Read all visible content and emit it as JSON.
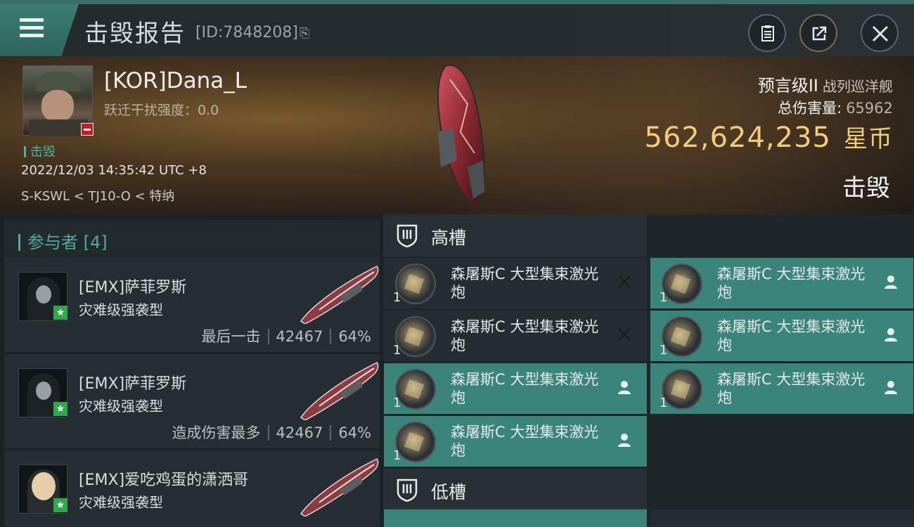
{
  "header": {
    "title": "击毁报告",
    "report_id": "[ID:7848208]"
  },
  "victim": {
    "name": "[KOR]Dana_L",
    "warp_label": "跃迁干扰强度：",
    "warp_value": "0.0",
    "kill_tag": "击毁",
    "timestamp": "2022/12/03 14:35:42 UTC +8",
    "location": "S-KSWL < TJ10-O < 特纳",
    "ship_name": "预言级II",
    "ship_class": "战列巡洋舰",
    "damage_label": "总伤害量:",
    "damage_value": "65962",
    "isk_value": "562,624,235",
    "isk_unit": "星币",
    "result": "击毁"
  },
  "participants": {
    "title": "参与者 [4]",
    "items": [
      {
        "name": "[EMX]萨菲罗斯",
        "ship": "灾难级强袭型",
        "role": "最后一击",
        "damage": "42467",
        "percent": "64%"
      },
      {
        "name": "[EMX]萨菲罗斯",
        "ship": "灾难级强袭型",
        "role": "造成伤害最多",
        "damage": "42467",
        "percent": "64%"
      },
      {
        "name": "[EMX]爱吃鸡蛋的潇洒哥",
        "ship": "灾难级强袭型"
      }
    ]
  },
  "fitting": {
    "high_slot_label": "高槽",
    "low_slot_label": "低槽",
    "modules": [
      {
        "name": "森屠斯C 大型集束激光炮",
        "qty": "1",
        "status": "destroyed"
      },
      {
        "name": "森屠斯C 大型集束激光炮",
        "qty": "1",
        "status": "dropped"
      },
      {
        "name": "森屠斯C 大型集束激光炮",
        "qty": "1",
        "status": "destroyed"
      },
      {
        "name": "森屠斯C 大型集束激光炮",
        "qty": "1",
        "status": "dropped"
      },
      {
        "name": "森屠斯C 大型集束激光炮",
        "qty": "1",
        "status": "dropped"
      },
      {
        "name": "森屠斯C 大型集束激光炮",
        "qty": "1",
        "status": "dropped"
      },
      {
        "name": "森屠斯C 大型集束激光炮",
        "qty": "1",
        "status": "dropped"
      }
    ]
  },
  "icons": {
    "menu": "menu-icon",
    "clipboard": "clipboard-icon",
    "share": "share-icon",
    "close": "close-icon",
    "destroyed": "x-icon",
    "dropped": "person-icon",
    "slot": "slot-icon"
  },
  "colors": {
    "accent": "#3d7d74",
    "isk": "#f1cc7a",
    "dropped_bg": "#3b847a",
    "destroyed_bg": "#242d31"
  }
}
